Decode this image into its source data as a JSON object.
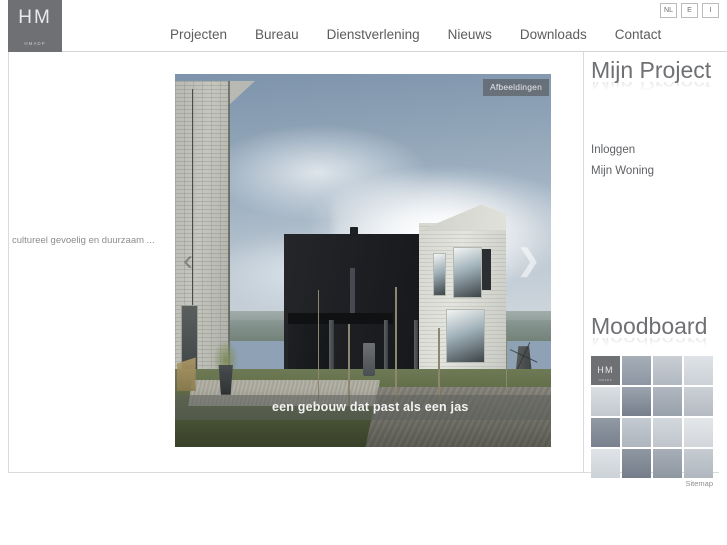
{
  "site": {
    "logo_mark": "HM",
    "logo_sub": "HMADP"
  },
  "nav": {
    "items": [
      {
        "label": "Projecten"
      },
      {
        "label": "Bureau"
      },
      {
        "label": "Dienstverlening"
      },
      {
        "label": "Nieuws"
      },
      {
        "label": "Downloads"
      },
      {
        "label": "Contact"
      }
    ]
  },
  "lang": {
    "options": [
      {
        "code": "NL"
      },
      {
        "code": "E"
      },
      {
        "code": "I"
      }
    ]
  },
  "left": {
    "tagline": "cultureel gevoelig en duurzaam ..."
  },
  "slideshow": {
    "badge": "Afbeeldingen",
    "caption": "een gebouw dat past als een jas",
    "prev_arrow": "‹",
    "next_arrow": "❯"
  },
  "sidebar": {
    "project_panel": {
      "title": "Mijn Project",
      "links": [
        {
          "label": "Inloggen"
        },
        {
          "label": "Mijn Woning"
        }
      ]
    },
    "moodboard": {
      "title": "Moodboard",
      "logo_mark": "HM",
      "logo_sub": "HMADP",
      "tiles": [
        {
          "id": "t1",
          "logo": true,
          "top": "#7b7d80",
          "bottom": "#5f6164"
        },
        {
          "id": "t2",
          "logo": false,
          "top": "#a6aeb8",
          "bottom": "#8d96a2"
        },
        {
          "id": "t3",
          "logo": false,
          "top": "#c9ced4",
          "bottom": "#b1b8c0"
        },
        {
          "id": "t4",
          "logo": false,
          "top": "#dfe3e7",
          "bottom": "#ccd1d7"
        },
        {
          "id": "t5",
          "logo": false,
          "top": "#dbdfe3",
          "bottom": "#c3c8ce"
        },
        {
          "id": "t6",
          "logo": false,
          "top": "#9aa3ae",
          "bottom": "#767f8b"
        },
        {
          "id": "t7",
          "logo": false,
          "top": "#b0b7c0",
          "bottom": "#98a0aa"
        },
        {
          "id": "t8",
          "logo": false,
          "top": "#ccd1d7",
          "bottom": "#b4bac1"
        },
        {
          "id": "t9",
          "logo": false,
          "top": "#9099a4",
          "bottom": "#78818d"
        },
        {
          "id": "t10",
          "logo": false,
          "top": "#c4cad1",
          "bottom": "#aeb5bd"
        },
        {
          "id": "t11",
          "logo": false,
          "top": "#d3d8dd",
          "bottom": "#bfc5cb"
        },
        {
          "id": "t12",
          "logo": false,
          "top": "#e4e7ea",
          "bottom": "#d2d6da"
        },
        {
          "id": "t13",
          "logo": false,
          "top": "#e0e4e8",
          "bottom": "#cdd2d7"
        },
        {
          "id": "t14",
          "logo": false,
          "top": "#8e97a2",
          "bottom": "#747d89"
        },
        {
          "id": "t15",
          "logo": false,
          "top": "#a7aeb7",
          "bottom": "#8f97a1"
        },
        {
          "id": "t16",
          "logo": false,
          "top": "#c6ccd2",
          "bottom": "#b0b7bf"
        }
      ]
    }
  },
  "footer": {
    "sitemap": "Sitemap"
  },
  "colors": {
    "brand_gray": "#6e7073",
    "rule": "#d9dbdd",
    "text": "#5c5c5c"
  }
}
